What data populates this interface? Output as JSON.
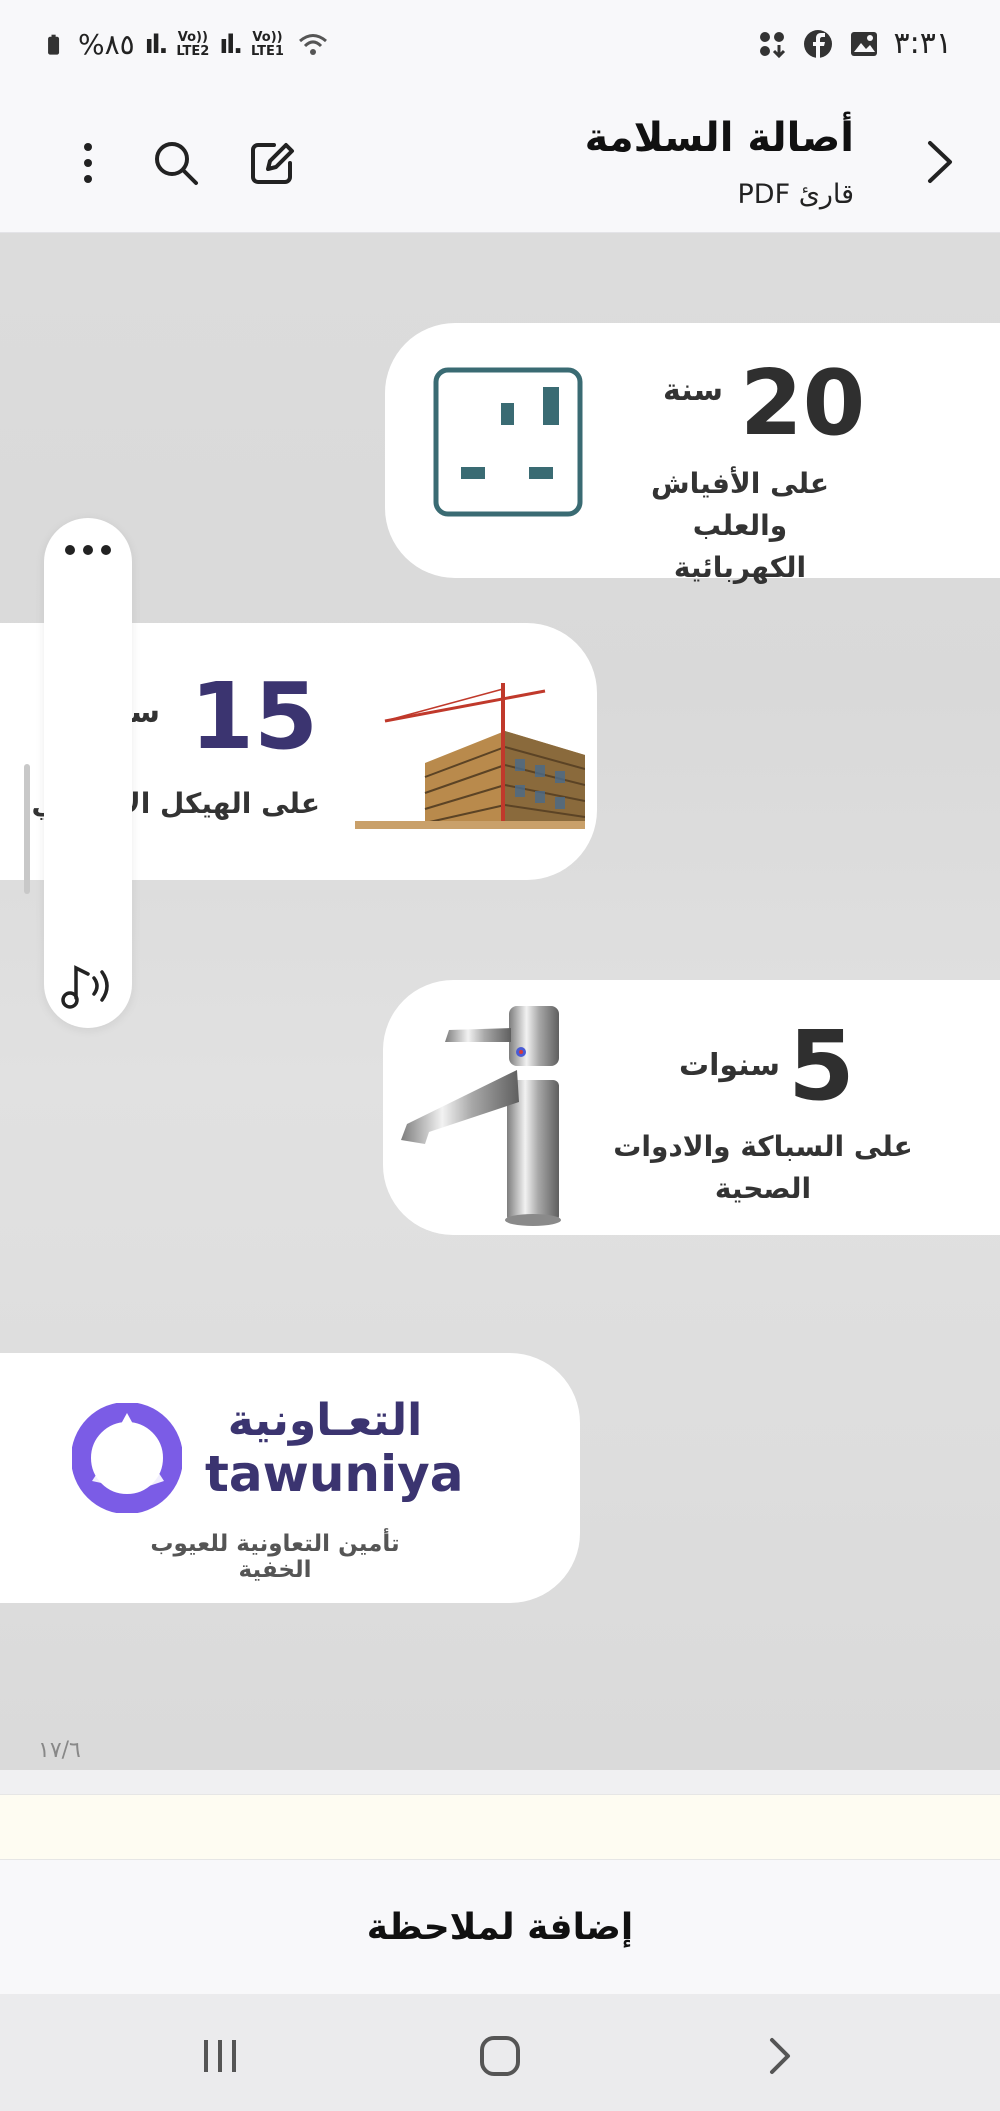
{
  "status_bar": {
    "time": "٣:٣١",
    "battery": "%٨٥",
    "sim1": "LTE2",
    "sim2": "LTE1",
    "volte": "Vo))"
  },
  "app_bar": {
    "title": "أصالة السلامة",
    "subtitle": "قارئ PDF"
  },
  "page": {
    "card1": {
      "number": "20",
      "unit": "سنة",
      "line1": "على الأفياش والعلب",
      "line2": "الكهربائية"
    },
    "card2": {
      "number": "15",
      "unit": "سنة",
      "line1": "على الهيكل الإنشائي"
    },
    "card3": {
      "number": "5",
      "unit": "سنوات",
      "line1": "على السباكة والادوات",
      "line2": "الصحية"
    },
    "logo": {
      "arabic": "التعـاونية",
      "latin": "tawuniya",
      "tagline": "تأمين التعاونية للعيوب الخفية"
    },
    "page_indicator": "١٧/٦"
  },
  "note_button": "إضافة لملاحظة",
  "colors": {
    "socket": "#3a6b73",
    "navy": "#3b3470",
    "logo_purple": "#7b5ce6"
  }
}
